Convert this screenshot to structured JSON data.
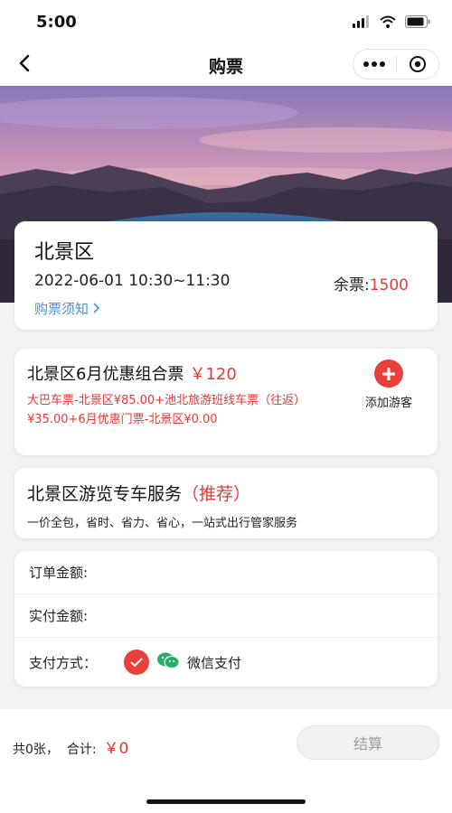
{
  "status_bar": {
    "time": "5:00"
  },
  "nav": {
    "title": "购票"
  },
  "info": {
    "title": "北景区",
    "time": "2022-06-01 10:30~11:30",
    "remain_label": "余票:",
    "remain_value": "1500",
    "notice": "购票须知"
  },
  "ticket": {
    "name": "北景区6月优惠组合票",
    "price": "￥120",
    "desc": "大巴车票-北景区¥85.00+池北旅游班线车票（往返）¥35.00+6月优惠门票-北景区¥0.00",
    "add_label": "添加游客"
  },
  "service": {
    "title": "北景区游览专车服务",
    "tag": "（推荐）",
    "desc": "一价全包，省时、省力、省心，一站式出行管家服务"
  },
  "payment": {
    "order_label": "订单金额:",
    "actual_label": "实付金额:",
    "method_label": "支付方式：",
    "method_name": "微信支付"
  },
  "bottom": {
    "count": "共0张，",
    "total_label": "合计:",
    "total_value": "￥0",
    "checkout": "结算"
  },
  "colors": {
    "accent_red": "#e53935",
    "link_blue": "#4a90d9",
    "wechat_green": "#2aae67"
  },
  "icons": [
    "back-icon",
    "more-icon",
    "target-icon",
    "plus-icon",
    "check-icon",
    "wechat-icon",
    "chevron-right-icon",
    "signal-icon",
    "wifi-icon",
    "battery-icon"
  ]
}
